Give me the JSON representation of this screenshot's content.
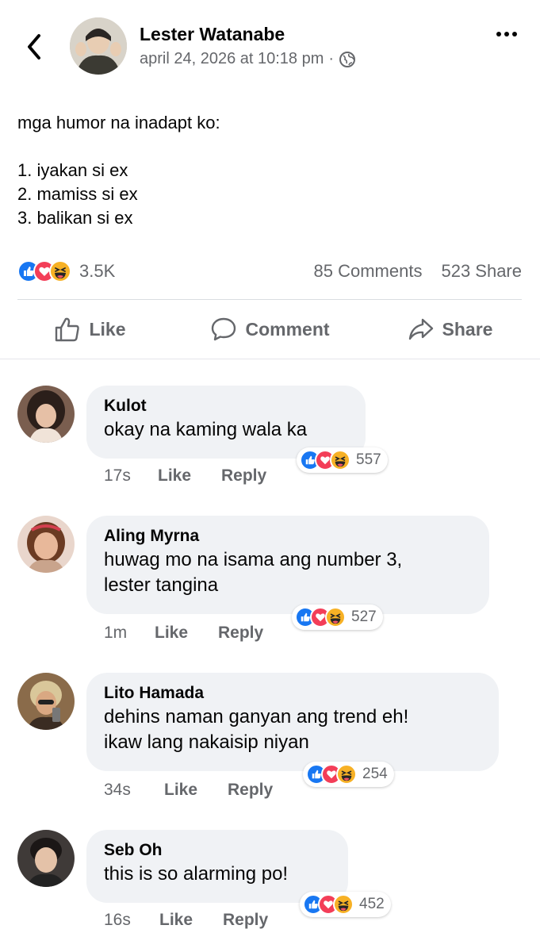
{
  "post": {
    "author": "Lester Watanabe",
    "date": "april 24, 2026 at 10:18 pm",
    "separator": "·",
    "body_lines": [
      "mga humor na inadapt ko:",
      "",
      "1. iyakan si ex",
      "2. mamiss si ex",
      "3. balikan si ex"
    ],
    "reaction_count": "3.5K",
    "comments_count": "85 Comments",
    "shares_count": "523 Share"
  },
  "actions": {
    "like": "Like",
    "comment": "Comment",
    "share": "Share"
  },
  "comments": [
    {
      "name": "Kulot",
      "text_lines": [
        "okay na kaming wala ka"
      ],
      "time": "17s",
      "like": "Like",
      "reply": "Reply",
      "reactions": "557"
    },
    {
      "name": "Aling Myrna",
      "text_lines": [
        "huwag mo na isama ang number 3,",
        "lester tangina"
      ],
      "time": "1m",
      "like": "Like",
      "reply": "Reply",
      "reactions": "527"
    },
    {
      "name": "Lito Hamada",
      "text_lines": [
        "dehins naman ganyan ang trend eh!",
        "ikaw lang nakaisip niyan"
      ],
      "time": "34s",
      "like": "Like",
      "reply": "Reply",
      "reactions": "254"
    },
    {
      "name": "Seb Oh",
      "text_lines": [
        "this is so alarming po!"
      ],
      "time": "16s",
      "like": "Like",
      "reply": "Reply",
      "reactions": "452"
    }
  ],
  "icons": {
    "back": "chevron-left-icon",
    "more": "more-horizontal-icon",
    "audience": "globe-icon",
    "like": "thumbs-up-icon",
    "comment": "comment-bubble-icon",
    "share": "share-arrow-icon",
    "reaction_like": "like-reaction-icon",
    "reaction_love": "love-reaction-icon",
    "reaction_haha": "haha-reaction-icon"
  },
  "colors": {
    "like_blue": "#1877f2",
    "love_red": "#f33e58",
    "haha_yellow": "#f7b125",
    "secondary_text": "#65676b",
    "bubble_bg": "#f0f2f5"
  }
}
